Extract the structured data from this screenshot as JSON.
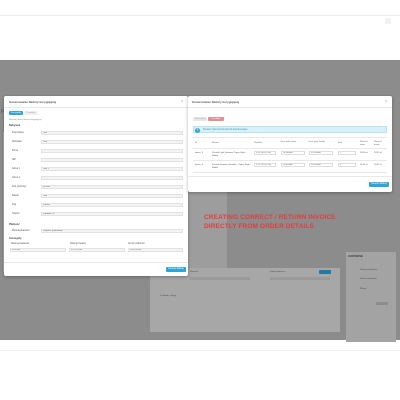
{
  "backdrop": {
    "left_small_label": "Pr",
    "panel_section_label": "Produkty i usługi",
    "right_panel_title": "ZAMÓWIENIE",
    "right_panel_items": [
      "Wersja zamówienia",
      "Status zamówienia",
      "Wersja"
    ],
    "right_panel_value": "Zapisz",
    "mid_labels": [
      "Płatność",
      "Kwota płatności"
    ]
  },
  "modal_left": {
    "title": "Generowanie faktury korygującej",
    "close_label": "×",
    "tabs": [
      "Szczegóły",
      "Produkty"
    ],
    "hint": "Wypełnij dane faktury korygującej",
    "section_buyer": "Nabywca",
    "buyer_fields": [
      {
        "label": "Imię/nazwa",
        "value": "Test"
      },
      {
        "label": "Nazwisko",
        "value": "Test"
      },
      {
        "label": "Firma",
        "value": ""
      },
      {
        "label": "NIP",
        "value": ""
      },
      {
        "label": "Adres 1",
        "value": "Test 1"
      },
      {
        "label": "Adres 2",
        "value": ""
      },
      {
        "label": "Kod pocztowy",
        "value": "00-000"
      },
      {
        "label": "Miasto",
        "value": "Test"
      },
      {
        "label": "Kraj",
        "value": "Polska"
      },
      {
        "label": "Telefon",
        "value": "Portable 10"
      }
    ],
    "section_payment": "Płatność",
    "payment_label": "Metoda płatności",
    "payment_value": "Płatność przelewem",
    "section_details": "Szczegóły",
    "detail_labels": [
      "Data wystawienia",
      "Data sprzedaży",
      "Termin płatności"
    ],
    "detail_values": [
      "12.2016",
      "12.12.2016",
      "13.12.2016"
    ],
    "submit_label": "Generuj fakturę"
  },
  "modal_right": {
    "title": "Generowanie faktury korygującej",
    "close_label": "×",
    "tabs": [
      "Szczegóły",
      "Produkty"
    ],
    "info_text": "Zaznacz ilości do korekty lub zwrotu towaru.",
    "columns": [
      "ID",
      "Nazwa",
      "Podatek",
      "Cena jedn. netto",
      "Cena jedn. brutto",
      "Ilość",
      "Wartość netto",
      "Wartość brutto"
    ],
    "rows": [
      {
        "id": "demo_3",
        "name": "Printed Light Summer Paper Style - Model",
        "tax": "PTU 23% (23%)",
        "net": "24.000000",
        "gross": "29.520000",
        "qty": "1",
        "total_net": "24,00 zł",
        "total_gross": "29,52 zł"
      },
      {
        "id": "demo_4",
        "name": "Printed Summer Sandals - Paper Style - Model",
        "tax": "PTU 23% (23%)",
        "net": "16.510000",
        "gross": "20.310000",
        "qty": "1",
        "total_net": "16,51 zł",
        "total_gross": "20,31 zł"
      }
    ],
    "submit_label": "Generuj fakturę"
  },
  "caption": {
    "line1": "CREATING CORRECT / RETURN INVOICE",
    "line2": "DIRECTLY FROM ORDER DETAILS"
  },
  "colors": {
    "accent": "#2ea4d8",
    "backdrop": "#8c8c8c",
    "caption_red": "#e33d3d",
    "tab_active": "#2ea4d8",
    "tab_red": "#e08f8f"
  }
}
